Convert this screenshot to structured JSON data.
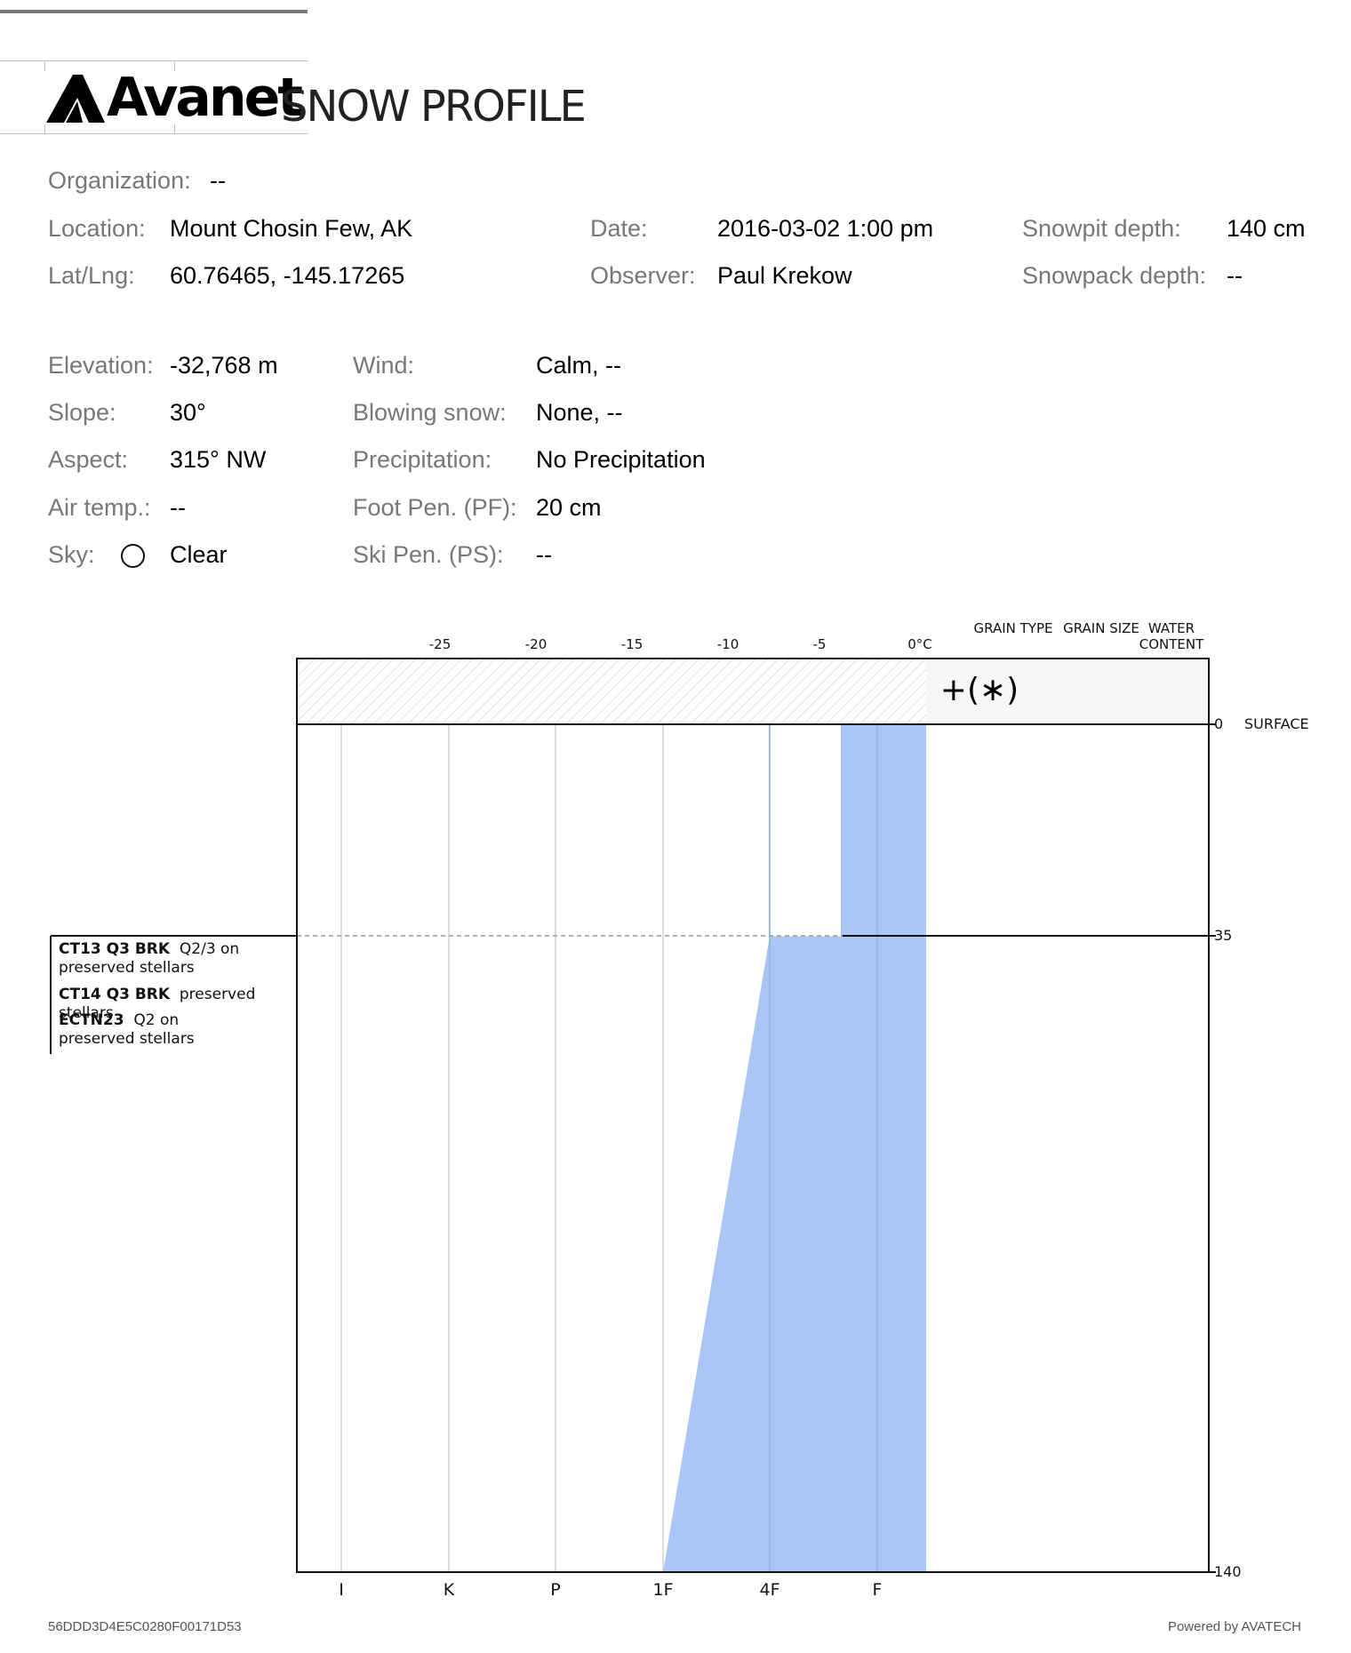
{
  "brand": {
    "name": "Avanet",
    "subtitle": "SNOW PROFILE"
  },
  "meta": {
    "organization": {
      "label": "Organization:",
      "value": "--"
    },
    "location": {
      "label": "Location:",
      "value": "Mount Chosin Few, AK"
    },
    "latlng": {
      "label": "Lat/Lng:",
      "value": "60.76465, -145.17265"
    },
    "date": {
      "label": "Date:",
      "value": "2016-03-02 1:00 pm"
    },
    "observer": {
      "label": "Observer:",
      "value": "Paul Krekow"
    },
    "snowpit_depth": {
      "label": "Snowpit depth:",
      "value": "140 cm"
    },
    "snowpack_depth": {
      "label": "Snowpack depth:",
      "value": "--"
    }
  },
  "conditions": {
    "elevation": {
      "label": "Elevation:",
      "value": "-32,768 m"
    },
    "slope": {
      "label": "Slope:",
      "value": "30°"
    },
    "aspect": {
      "label": "Aspect:",
      "value": "315° NW"
    },
    "air_temp": {
      "label": "Air temp.:",
      "value": "--"
    },
    "sky": {
      "label": "Sky:",
      "value": "Clear",
      "icon": "clear-sky-circle-icon"
    },
    "wind": {
      "label": "Wind:",
      "value": "Calm, --"
    },
    "blowing_snow": {
      "label": "Blowing snow:",
      "value": "None, --"
    },
    "precipitation": {
      "label": "Precipitation:",
      "value": "No Precipitation"
    },
    "foot_pen": {
      "label": "Foot Pen. (PF):",
      "value": "20 cm"
    },
    "ski_pen": {
      "label": "Ski Pen. (PS):",
      "value": "--"
    }
  },
  "chart_data": {
    "type": "area",
    "temperature_ticks": [
      "-25",
      "-20",
      "-15",
      "-10",
      "-5",
      "0°C"
    ],
    "hardness_ticks": [
      "I",
      "K",
      "P",
      "1F",
      "4F",
      "F"
    ],
    "columns": {
      "grain_type": "GRAIN TYPE",
      "grain_size": "GRAIN SIZE",
      "water_content": "WATER CONTENT"
    },
    "surface_grain_symbol": "+(∗)",
    "depth_labels": {
      "surface": "0",
      "surface_name": "SURFACE",
      "layer_boundary": "35",
      "bottom": "140"
    },
    "depth_range_cm": [
      0,
      140
    ],
    "layers": [
      {
        "top_cm": 0,
        "bottom_cm": 35,
        "hardness_top": "4F-F",
        "hardness_bottom": "4F-F"
      },
      {
        "top_cm": 35,
        "bottom_cm": 140,
        "hardness_top": "4F",
        "hardness_bottom": "1F"
      }
    ],
    "fill_color": "#a9c6f7",
    "grid_color": "#d0d0d0"
  },
  "tests": [
    {
      "code": "CT13 Q3 BRK",
      "note": "Q2/3 on preserved stellars"
    },
    {
      "code": "CT14 Q3 BRK",
      "note": "preserved stellars"
    },
    {
      "code": "ECTN23",
      "note": "Q2 on preserved stellars"
    }
  ],
  "footer": {
    "id": "56DDD3D4E5C0280F00171D53",
    "powered": "Powered by AVATECH"
  }
}
